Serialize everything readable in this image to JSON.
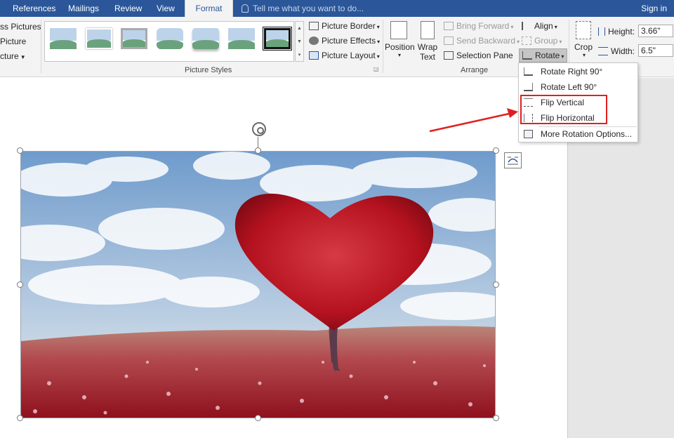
{
  "tabs": [
    {
      "label": "References",
      "active": false
    },
    {
      "label": "Mailings",
      "active": false
    },
    {
      "label": "Review",
      "active": false
    },
    {
      "label": "View",
      "active": false
    },
    {
      "label": "Format",
      "active": true
    }
  ],
  "tell_me": {
    "placeholder": "Tell me what you want to do..."
  },
  "account": {
    "sign_in": "Sign in"
  },
  "adjust": {
    "compress_pictures": "ss Pictures",
    "change_picture": "Picture",
    "reset_picture": "cture"
  },
  "picture_styles": {
    "label": "Picture Styles",
    "picture_border": "Picture Border",
    "picture_effects": "Picture Effects",
    "picture_layout": "Picture Layout"
  },
  "arrange": {
    "label": "Arrange",
    "position": "Position",
    "wrap_text_line1": "Wrap",
    "wrap_text_line2": "Text",
    "bring_forward": "Bring Forward",
    "send_backward": "Send Backward",
    "selection_pane": "Selection Pane",
    "align": "Align",
    "group": "Group",
    "rotate": "Rotate"
  },
  "size": {
    "crop": "Crop",
    "height_label": "Height:",
    "height_value": "3.66\"",
    "width_label": "Width:",
    "width_value": "6.5\""
  },
  "rotate_menu": {
    "items": [
      {
        "label": "Rotate Right 90°",
        "icon": "rotate-right-icon"
      },
      {
        "label": "Rotate Left 90°",
        "icon": "rotate-left-icon"
      },
      {
        "label": "Flip Vertical",
        "icon": "flip-vertical-icon"
      },
      {
        "label": "Flip Horizontal",
        "icon": "flip-horizontal-icon"
      },
      {
        "label": "More Rotation Options...",
        "icon": "rotation-options-icon"
      }
    ]
  },
  "colors": {
    "ribbon_blue": "#2b579a",
    "highlight_red": "#e02020",
    "heart_red": "#c81e2b"
  }
}
